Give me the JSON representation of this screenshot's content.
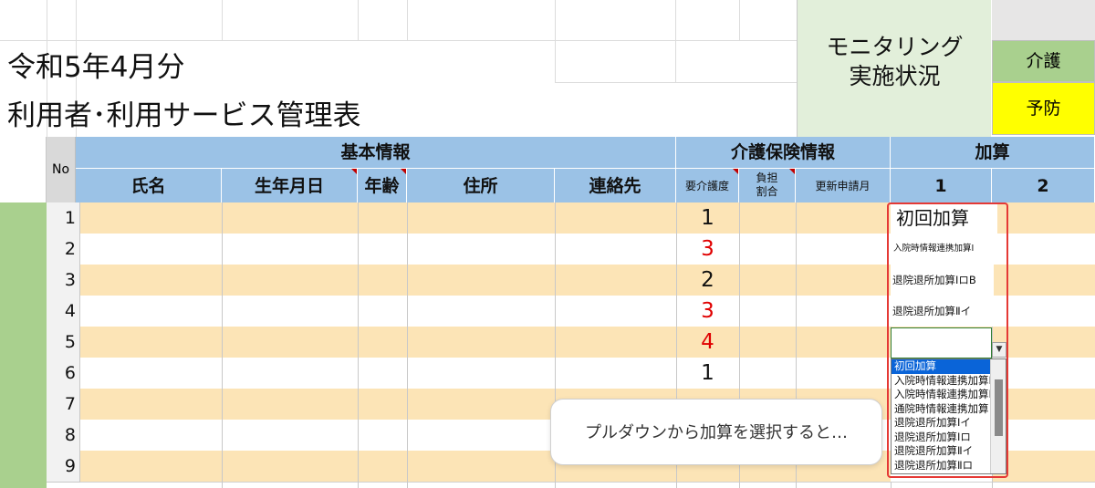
{
  "title": {
    "line1": "令和5年4月分",
    "line2": "利用者･利用サービス管理表"
  },
  "monitoring": {
    "line1": "モニタリング",
    "line2": "実施状況",
    "kaigo": "介護",
    "yobo": "予防"
  },
  "header": {
    "no": "No",
    "groups": {
      "basic": "基本情報",
      "insurance": "介護保険情報",
      "kasan": "加算"
    },
    "columns": {
      "name": "氏名",
      "birthday": "生年月日",
      "age": "年齢",
      "address": "住所",
      "contact": "連絡先",
      "care_level": "要介護度",
      "burden_line1": "負担",
      "burden_line2": "割合",
      "renewal": "更新申請月",
      "kasan1": "1",
      "kasan2": "2"
    }
  },
  "rows": [
    {
      "no": "1",
      "care_level": "1",
      "kasan1": "初回加算"
    },
    {
      "no": "2",
      "care_level": "3",
      "kasan1": "入院時情報連携加算Ⅰ"
    },
    {
      "no": "3",
      "care_level": "2",
      "kasan1": "退院退所加算ⅠロB"
    },
    {
      "no": "4",
      "care_level": "3",
      "kasan1": "退院退所加算Ⅱイ"
    },
    {
      "no": "5",
      "care_level": "4",
      "kasan1": ""
    },
    {
      "no": "6",
      "care_level": "1",
      "kasan1": ""
    },
    {
      "no": "7",
      "care_level": "",
      "kasan1": ""
    },
    {
      "no": "8",
      "care_level": "",
      "kasan1": ""
    },
    {
      "no": "9",
      "care_level": "",
      "kasan1": ""
    }
  ],
  "dropdown": {
    "options": [
      "初回加算",
      "入院時情報連携加算Ⅰ",
      "入院時情報連携加算Ⅱ",
      "通院時情報連携加算",
      "退院退所加算Ⅰイ",
      "退院退所加算Ⅰロ",
      "退院退所加算Ⅱイ",
      "退院退所加算Ⅱロ"
    ],
    "selected_index": 0
  },
  "tooltip": "プルダウンから加算を選択すると…",
  "colors": {
    "header_blue": "#9bc2e6",
    "row_peach": "#fce4b6",
    "care_red": "#e00000",
    "highlight_red": "#e53935",
    "monitor_green": "#e2efda",
    "kaigo_green": "#a9d08e",
    "yobo_yellow": "#ffff00"
  }
}
